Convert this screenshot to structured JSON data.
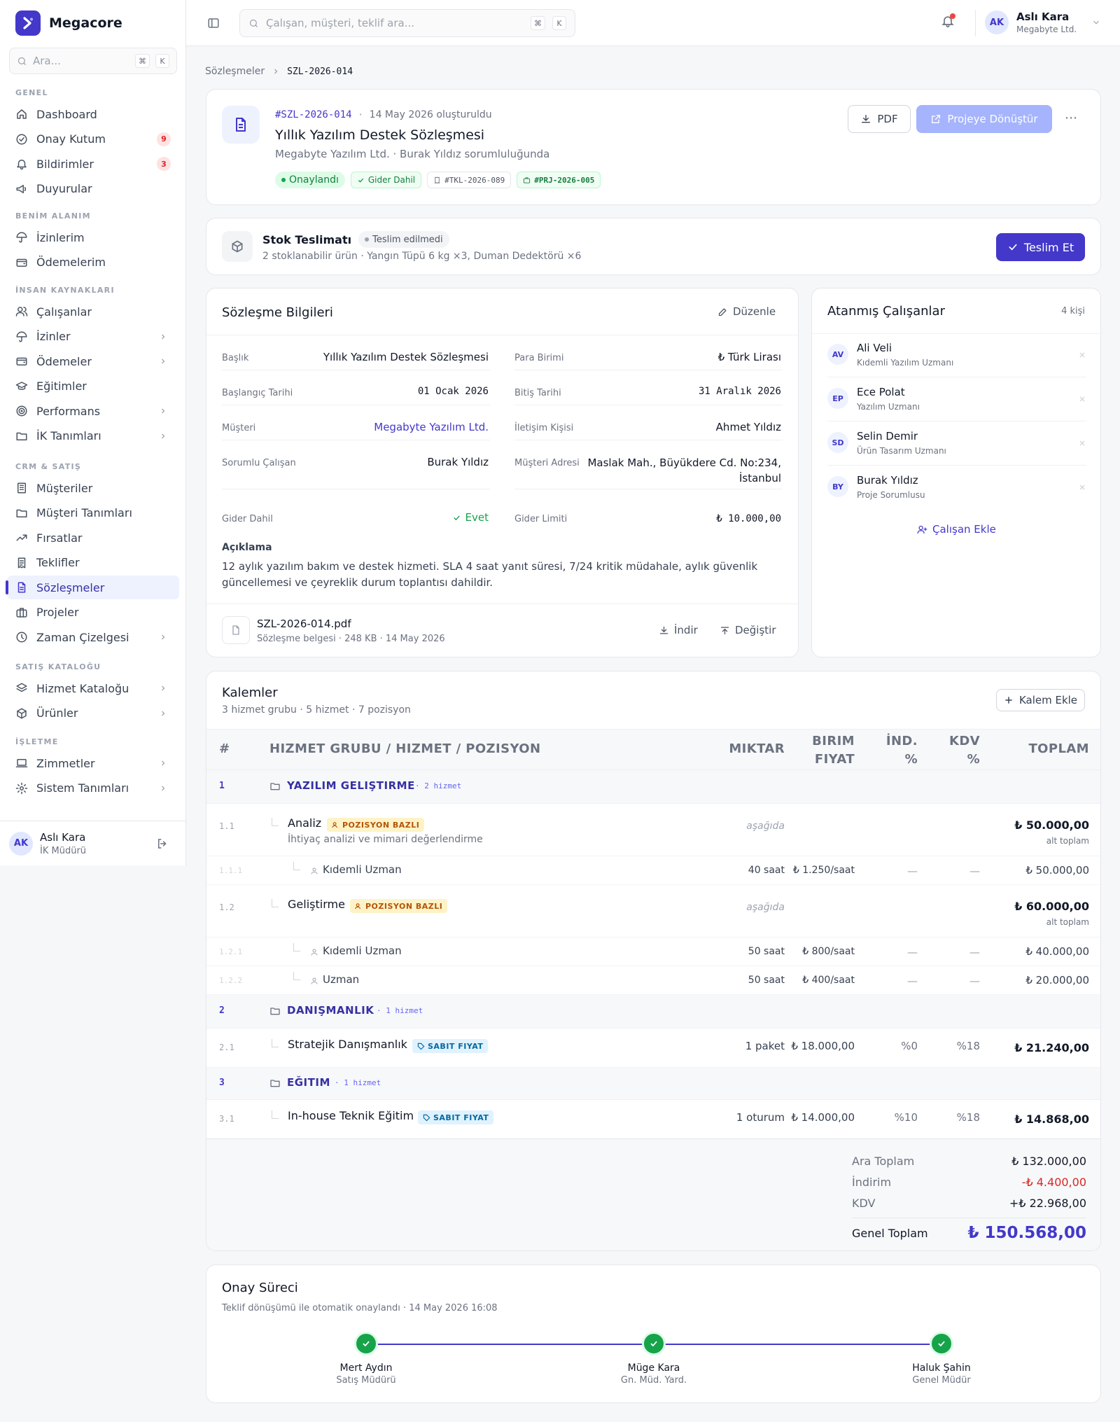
{
  "app": {
    "name": "Megacore",
    "search_placeholder": "Ara...",
    "kbd1": "⌘",
    "kbd2": "K"
  },
  "sidebar": {
    "sections": [
      {
        "title": "GENEL",
        "items": [
          {
            "label": "Dashboard",
            "icon": "home-icon"
          },
          {
            "label": "Onay Kutum",
            "icon": "check-circle-icon",
            "badge": "9"
          },
          {
            "label": "Bildirimler",
            "icon": "bell-icon",
            "badge": "3"
          },
          {
            "label": "Duyurular",
            "icon": "megaphone-icon"
          }
        ]
      },
      {
        "title": "BENİM ALANIM",
        "items": [
          {
            "label": "İzinlerim",
            "icon": "umbrella-icon"
          },
          {
            "label": "Ödemelerim",
            "icon": "wallet-icon"
          }
        ]
      },
      {
        "title": "İNSAN KAYNAKLARI",
        "items": [
          {
            "label": "Çalışanlar",
            "icon": "users-icon"
          },
          {
            "label": "İzinler",
            "icon": "umbrella-icon",
            "chevron": true
          },
          {
            "label": "Ödemeler",
            "icon": "wallet-icon",
            "chevron": true
          },
          {
            "label": "Eğitimler",
            "icon": "graduation-icon"
          },
          {
            "label": "Performans",
            "icon": "target-icon",
            "chevron": true
          },
          {
            "label": "İK Tanımları",
            "icon": "folder-icon",
            "chevron": true
          }
        ]
      },
      {
        "title": "CRM & SATIŞ",
        "items": [
          {
            "label": "Müşteriler",
            "icon": "building-icon"
          },
          {
            "label": "Müşteri Tanımları",
            "icon": "folder-icon"
          },
          {
            "label": "Fırsatlar",
            "icon": "trend-icon"
          },
          {
            "label": "Teklifler",
            "icon": "receipt-icon"
          },
          {
            "label": "Sözleşmeler",
            "icon": "document-icon",
            "active": true
          },
          {
            "label": "Projeler",
            "icon": "briefcase-icon"
          },
          {
            "label": "Zaman Çizelgesi",
            "icon": "clock-icon",
            "chevron": true
          }
        ]
      },
      {
        "title": "SATIŞ KATALOĞU",
        "items": [
          {
            "label": "Hizmet Kataloğu",
            "icon": "layers-icon",
            "chevron": true
          },
          {
            "label": "Ürünler",
            "icon": "box-icon",
            "chevron": true
          }
        ]
      },
      {
        "title": "İŞLETME",
        "items": [
          {
            "label": "Zimmetler",
            "icon": "laptop-icon",
            "chevron": true
          },
          {
            "label": "Sistem Tanımları",
            "icon": "gear-icon",
            "chevron": true
          }
        ]
      }
    ],
    "user": {
      "initials": "AK",
      "name": "Aslı Kara",
      "role": "İK Müdürü"
    }
  },
  "topbar": {
    "search_placeholder": "Çalışan, müşteri, teklif ara...",
    "kbd1": "⌘",
    "kbd2": "K",
    "user": {
      "initials": "AK",
      "name": "Aslı Kara",
      "company": "Megabyte Ltd."
    }
  },
  "breadcrumb": {
    "parent": "Sözleşmeler",
    "current": "SZL-2026-014"
  },
  "header": {
    "code": "#SZL-2026-014",
    "created": "14 May 2026 oluşturuldu",
    "title": "Yıllık Yazılım Destek Sözleşmesi",
    "subtitle": "Megabyte Yazılım Ltd. · Burak Yıldız sorumluluğunda",
    "status": "Onaylandı",
    "expense_tag": "Gider Dahil",
    "quote_tag": "#TKL-2026-089",
    "project_tag": "#PRJ-2026-005",
    "pdf_label": "PDF",
    "convert_label": "Projeye Dönüştür",
    "more": "⋯"
  },
  "stock": {
    "title": "Stok Teslimatı",
    "status": "Teslim edilmedi",
    "description": "2 stoklanabilir ürün · Yangın Tüpü 6 kg ×3, Duman Dedektörü ×6",
    "button": "Teslim Et"
  },
  "contract_info": {
    "title": "Sözleşme Bilgileri",
    "edit_label": "Düzenle",
    "fields": {
      "baslik_label": "Başlık",
      "baslik_value": "Yıllık Yazılım Destek Sözleşmesi",
      "para_label": "Para Birimi",
      "para_value": "₺ Türk Lirası",
      "baslangic_label": "Başlangıç Tarihi",
      "baslangic_value": "01 Ocak 2026",
      "bitis_label": "Bitiş Tarihi",
      "bitis_value": "31 Aralık 2026",
      "musteri_label": "Müşteri",
      "musteri_value": "Megabyte Yazılım Ltd.",
      "iletisim_label": "İletişim Kişisi",
      "iletisim_value": "Ahmet Yıldız",
      "sorumlu_label": "Sorumlu Çalışan",
      "sorumlu_value": "Burak Yıldız",
      "adres_label": "Müşteri Adresi",
      "adres_line1": "Maslak Mah., Büyükdere Cd. No:234,",
      "adres_line2": "İstanbul",
      "gider_label": "Gider Dahil",
      "gider_value": "Evet",
      "limit_label": "Gider Limiti",
      "limit_value": "₺ 10.000,00"
    },
    "description_label": "Açıklama",
    "description_line1": "12 aylık yazılım bakım ve destek hizmeti. SLA 4 saat yanıt süresi, 7/24 kritik müdahale, aylık güvenlik",
    "description_line2": "güncellemesi ve çeyreklik durum toplantısı dahildir.",
    "file": {
      "name": "SZL-2026-014.pdf",
      "meta": "Sözleşme belgesi · 248 KB · 14 May 2026",
      "download": "İndir",
      "replace": "Değiştir"
    }
  },
  "assigned": {
    "title": "Atanmış Çalışanlar",
    "count": "4 kişi",
    "people": [
      {
        "initials": "AV",
        "name": "Ali Veli",
        "role": "Kıdemli Yazılım Uzmanı"
      },
      {
        "initials": "EP",
        "name": "Ece Polat",
        "role": "Yazılım Uzmanı"
      },
      {
        "initials": "SD",
        "name": "Selin Demir",
        "role": "Ürün Tasarım Uzmanı"
      },
      {
        "initials": "BY",
        "name": "Burak Yıldız",
        "role": "Proje Sorumlusu"
      }
    ],
    "add_label": "Çalışan Ekle"
  },
  "items": {
    "title": "Kalemler",
    "subtitle": "3 hizmet grubu · 5 hizmet · 7 pozisyon",
    "add_label": "Kalem Ekle",
    "headers": {
      "no": "#",
      "name": "HIZMET GRUBU / HIZMET / POZISYON",
      "qty": "MIKTAR",
      "price1": "BIRIM",
      "price2": "FIYAT",
      "disc1": "İND.",
      "disc2": "%",
      "vat1": "KDV",
      "vat2": "%",
      "total": "TOPLAM"
    },
    "g1": {
      "no": "1",
      "name": "YAZILIM GELIŞTIRME",
      "count": "· 2 hizmet"
    },
    "r11": {
      "no": "1.1",
      "name": "Analiz",
      "chip": "POZISYON BAZLI",
      "desc": "İhtiyaç analizi ve mimari değerlendirme",
      "qty": "aşağıda",
      "total": "₺ 50.000,00",
      "sub": "alt toplam"
    },
    "r111": {
      "no": "1.1.1",
      "name": "Kıdemli Uzman",
      "qty": "40 saat",
      "price": "₺ 1.250/saat",
      "disc": "—",
      "vat": "—",
      "total": "₺ 50.000,00"
    },
    "r12": {
      "no": "1.2",
      "name": "Geliştirme",
      "chip": "POZISYON BAZLI",
      "qty": "aşağıda",
      "total": "₺ 60.000,00",
      "sub": "alt toplam"
    },
    "r121": {
      "no": "1.2.1",
      "name": "Kıdemli Uzman",
      "qty": "50 saat",
      "price": "₺ 800/saat",
      "disc": "—",
      "vat": "—",
      "total": "₺ 40.000,00"
    },
    "r122": {
      "no": "1.2.2",
      "name": "Uzman",
      "qty": "50 saat",
      "price": "₺ 400/saat",
      "disc": "—",
      "vat": "—",
      "total": "₺ 20.000,00"
    },
    "g2": {
      "no": "2",
      "name": "DANIŞMANLIK",
      "count": "· 1 hizmet"
    },
    "r21": {
      "no": "2.1",
      "name": "Stratejik Danışmanlık",
      "chip": "SABIT FIYAT",
      "qty": "1 paket",
      "price": "₺ 18.000,00",
      "disc": "%0",
      "vat": "%18",
      "total": "₺ 21.240,00"
    },
    "g3": {
      "no": "3",
      "name": "EĞITIM",
      "count": "· 1 hizmet"
    },
    "r31": {
      "no": "3.1",
      "name": "In-house Teknik Eğitim",
      "chip": "SABIT FIYAT",
      "qty": "1 oturum",
      "price": "₺ 14.000,00",
      "disc": "%10",
      "vat": "%18",
      "total": "₺ 14.868,00"
    },
    "summary": {
      "subtotal_label": "Ara Toplam",
      "subtotal": "₺ 132.000,00",
      "discount_label": "İndirim",
      "discount": "-₺ 4.400,00",
      "vat_label": "KDV",
      "vat": "+₺ 22.968,00",
      "grand_label": "Genel Toplam",
      "grand": "₺ 150.568,00"
    }
  },
  "approval": {
    "title": "Onay Süreci",
    "subtitle": "Teklif dönüşümü ile otomatik onaylandı · 14 May 2026 16:08",
    "steps": [
      {
        "name": "Mert Aydın",
        "role": "Satış Müdürü"
      },
      {
        "name": "Müge Kara",
        "role": "Gn. Müd. Yard."
      },
      {
        "name": "Haluk Şahin",
        "role": "Genel Müdür"
      }
    ]
  },
  "colors": {
    "accent": "#4338ca",
    "success": "#16a34a",
    "danger": "#dc2626",
    "muted": "#6b7280"
  }
}
